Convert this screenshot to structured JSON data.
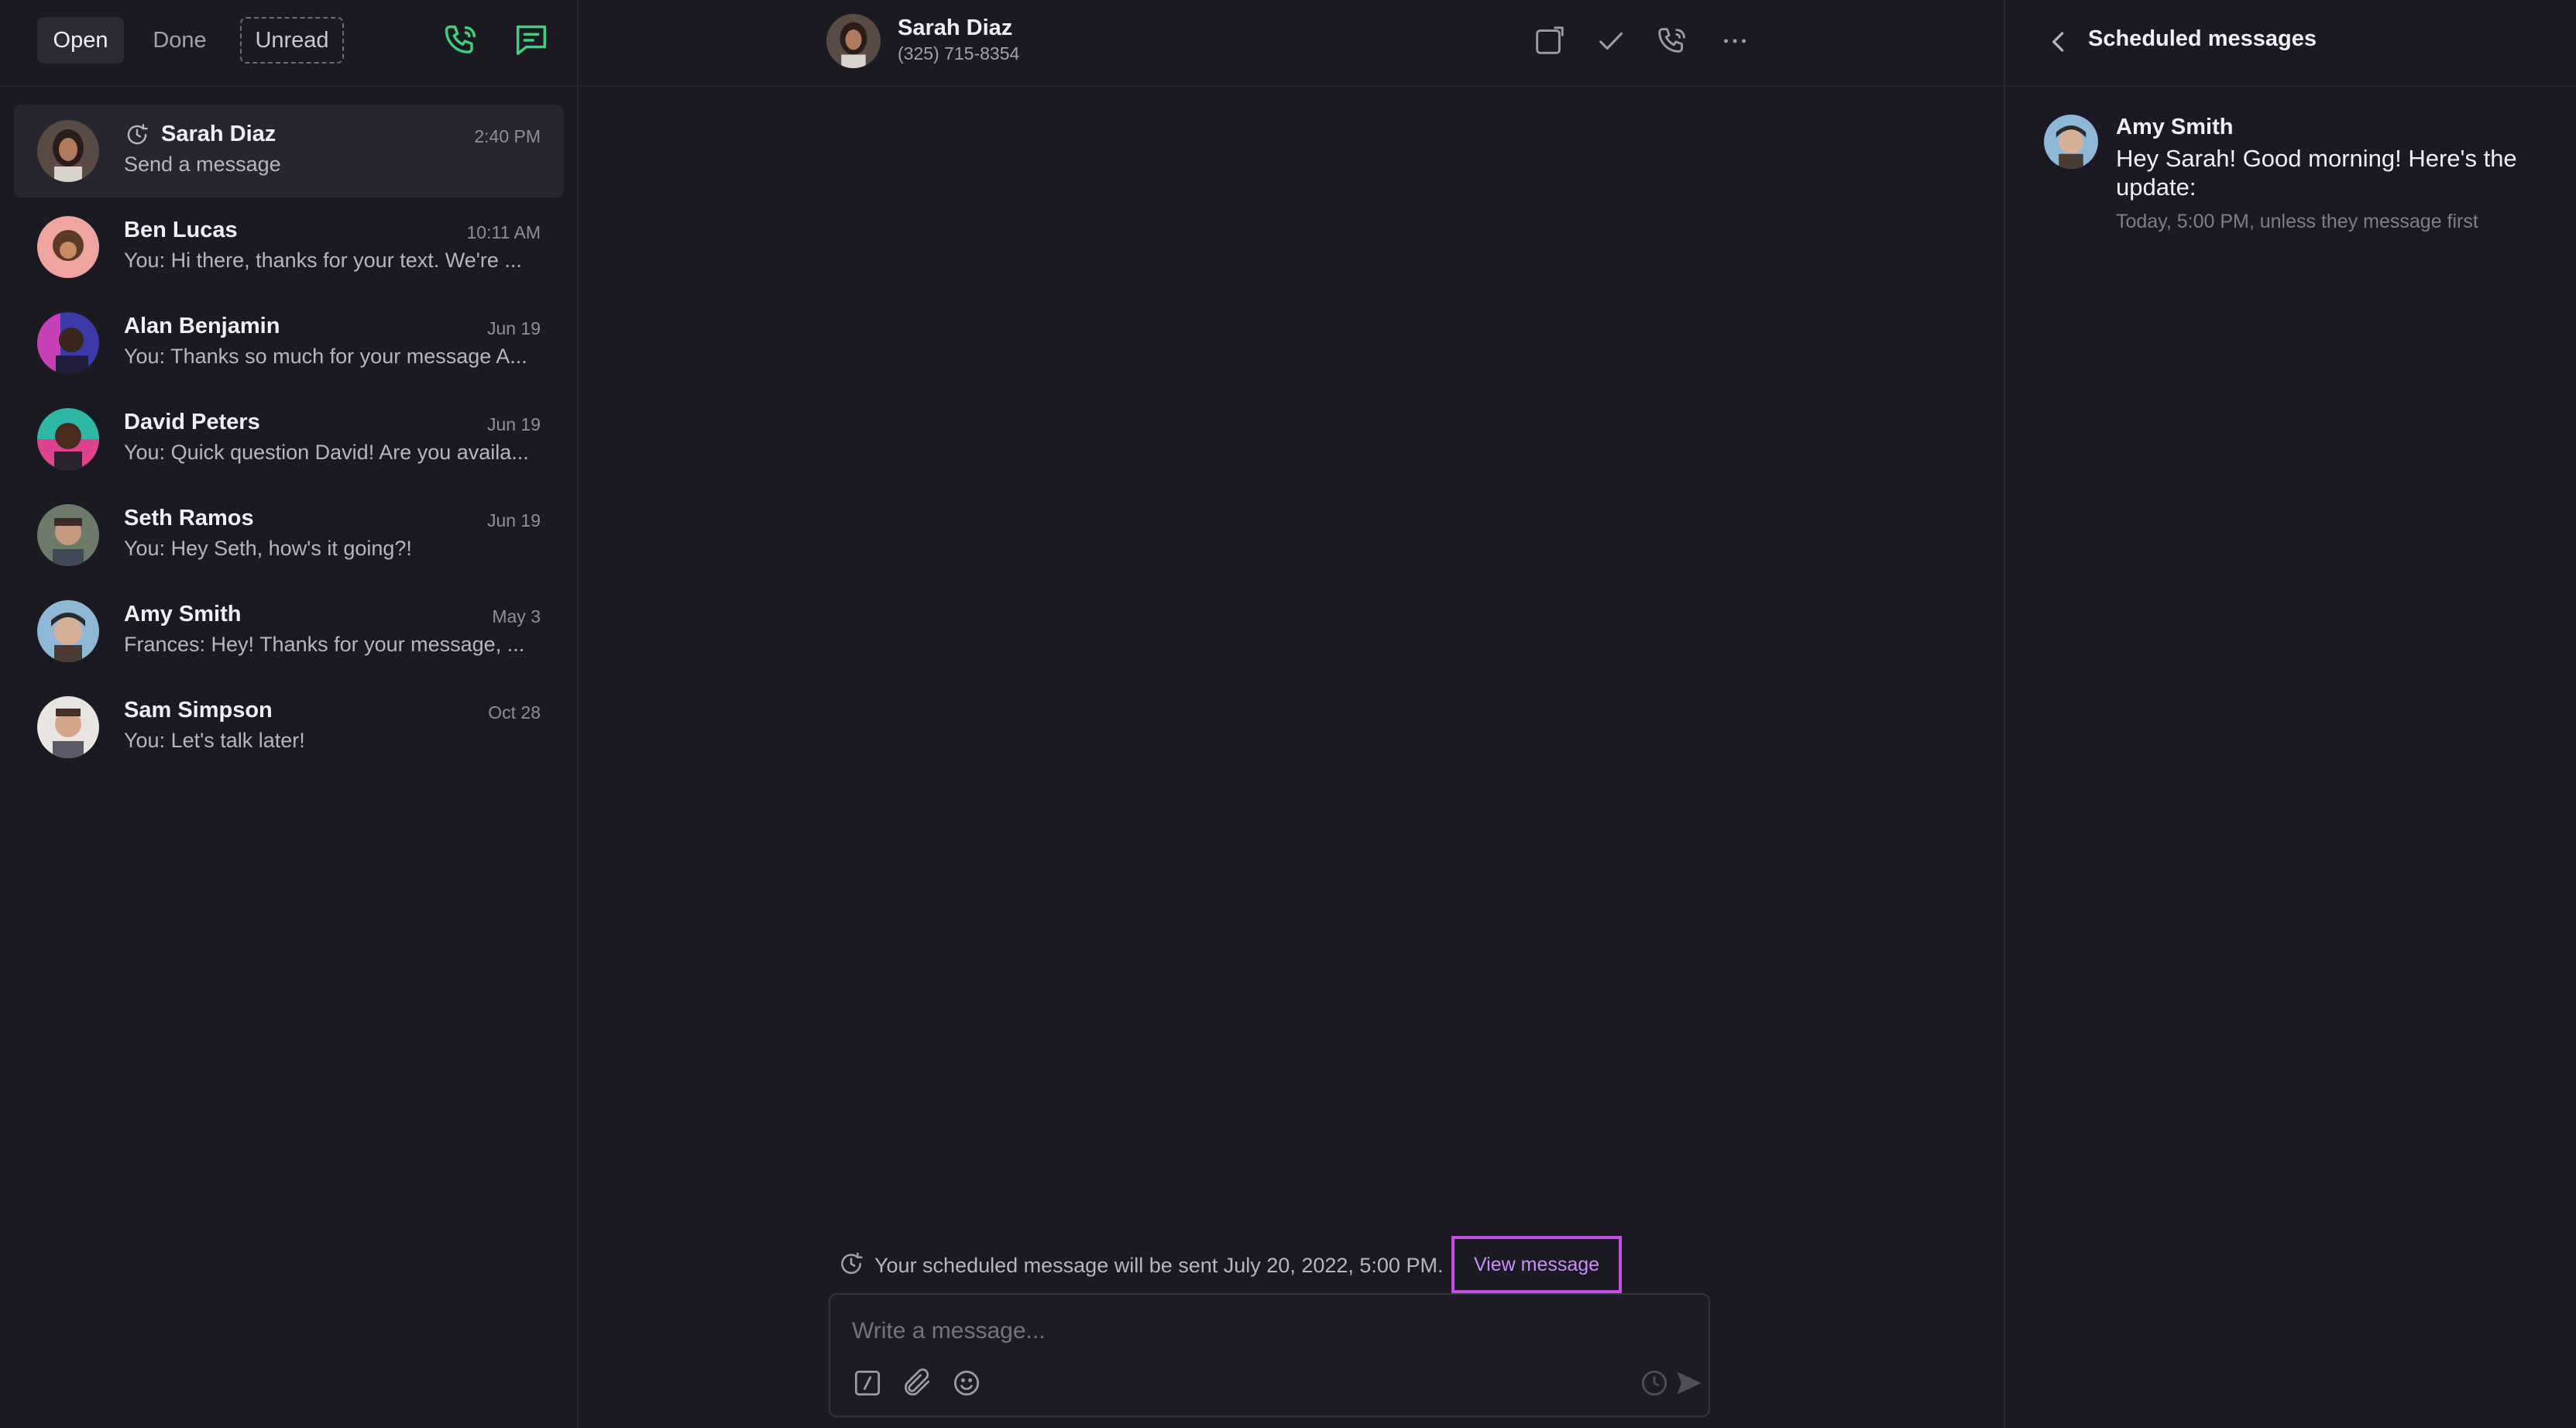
{
  "filters": {
    "open": "Open",
    "done": "Done",
    "unread": "Unread"
  },
  "conversations": [
    {
      "name": "Sarah Diaz",
      "time": "2:40 PM",
      "preview": "Send a message"
    },
    {
      "name": "Ben Lucas",
      "time": "10:11 AM",
      "preview": "You: Hi there, thanks for your text. We're ..."
    },
    {
      "name": "Alan Benjamin",
      "time": "Jun 19",
      "preview": "You: Thanks so much for your message A..."
    },
    {
      "name": "David Peters",
      "time": "Jun 19",
      "preview": "You: Quick question David! Are you availa..."
    },
    {
      "name": "Seth Ramos",
      "time": "Jun 19",
      "preview": "You: Hey Seth, how's it going?!"
    },
    {
      "name": "Amy Smith",
      "time": "May 3",
      "preview": "Frances: Hey! Thanks for your message, ..."
    },
    {
      "name": "Sam Simpson",
      "time": "Oct 28",
      "preview": "You: Let's talk later!"
    }
  ],
  "contact": {
    "name": "Sarah Diaz",
    "phone": "(325) 715-8354"
  },
  "notice": {
    "text": "Your scheduled message will be sent July 20, 2022, 5:00 PM.",
    "link": "View message"
  },
  "composer": {
    "placeholder": "Write a message..."
  },
  "scheduled": {
    "title": "Scheduled messages",
    "author": "Amy Smith",
    "body": "Hey Sarah! Good morning! Here's the update:",
    "meta": "Today, 5:00 PM, unless they message first"
  },
  "colors": {
    "accent_green": "#3fd07a",
    "highlight_purple": "#c84de8",
    "background": "#1b1a23"
  }
}
